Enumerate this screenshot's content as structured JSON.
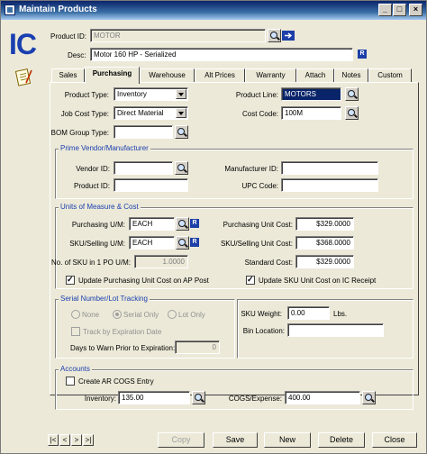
{
  "window": {
    "title": "Maintain Products"
  },
  "module": {
    "badge": "IC"
  },
  "header": {
    "product_id_label": "Product ID:",
    "product_id_value": "MOTOR",
    "desc_label": "Desc:",
    "desc_value": "Motor 160 HP - Serialized"
  },
  "tabs": [
    {
      "label": "Sales",
      "active": false
    },
    {
      "label": "Purchasing",
      "active": true
    },
    {
      "label": "Warehouse",
      "active": false
    },
    {
      "label": "Alt Prices",
      "active": false
    },
    {
      "label": "Warranty",
      "active": false
    },
    {
      "label": "Attach",
      "active": false
    },
    {
      "label": "Notes",
      "active": false
    },
    {
      "label": "Custom",
      "active": false
    }
  ],
  "general": {
    "product_type_label": "Product Type:",
    "product_type_value": "Inventory",
    "job_cost_type_label": "Job Cost Type:",
    "job_cost_type_value": "Direct Material",
    "bom_group_type_label": "BOM Group Type:",
    "bom_group_type_value": "",
    "product_line_label": "Product Line:",
    "product_line_value": "MOTORS",
    "cost_code_label": "Cost Code:",
    "cost_code_value": "100M"
  },
  "vendor": {
    "title": "Prime Vendor/Manufacturer",
    "vendor_id_label": "Vendor ID:",
    "vendor_id_value": "",
    "product_id_label": "Product ID:",
    "product_id_value": "",
    "manufacturer_id_label": "Manufacturer ID:",
    "manufacturer_id_value": "",
    "upc_label": "UPC Code:",
    "upc_value": ""
  },
  "uom": {
    "title": "Units of Measure & Cost",
    "purchasing_um_label": "Purchasing U/M:",
    "purchasing_um_value": "EACH",
    "sku_selling_um_label": "SKU/Selling U/M:",
    "sku_selling_um_value": "EACH",
    "sku_in_po_label": "No. of SKU in 1 PO U/M:",
    "sku_in_po_value": "1.0000",
    "purchasing_unit_cost_label": "Purchasing Unit Cost:",
    "purchasing_unit_cost_value": "$329.0000",
    "sku_selling_unit_cost_label": "SKU/Selling Unit Cost:",
    "sku_selling_unit_cost_value": "$368.0000",
    "standard_cost_label": "Standard Cost:",
    "standard_cost_value": "$329.0000",
    "update_purchasing_label": "Update Purchasing Unit Cost on AP Post",
    "update_sku_label": "Update SKU Unit Cost on IC Receipt"
  },
  "serial": {
    "title": "Serial Number/Lot Tracking",
    "none_label": "None",
    "serial_only_label": "Serial Only",
    "lot_only_label": "Lot Only",
    "track_expiration_label": "Track by Expiration Date",
    "days_warn_label": "Days to Warn Prior to Expiration:",
    "days_warn_value": "0"
  },
  "storage": {
    "sku_weight_label": "SKU Weight:",
    "sku_weight_value": "0.00",
    "weight_unit": "Lbs.",
    "bin_location_label": "Bin Location:",
    "bin_location_value": ""
  },
  "accounts": {
    "title": "Accounts",
    "create_cogs_label": "Create AR COGS Entry",
    "inventory_label": "Inventory:",
    "inventory_value": "135.00",
    "cogs_label": "COGS/Expense:",
    "cogs_value": "400.00"
  },
  "footer": {
    "copy_label": "Copy",
    "save_label": "Save",
    "new_label": "New",
    "delete_label": "Delete",
    "close_label": "Close"
  },
  "nav": {
    "first": "|<",
    "prev": "<",
    "next": ">",
    "last": ">|"
  },
  "colors": {
    "accent": "#1a3fb0",
    "title_gradient_start": "#0a246a",
    "selection": "#0a246a"
  }
}
